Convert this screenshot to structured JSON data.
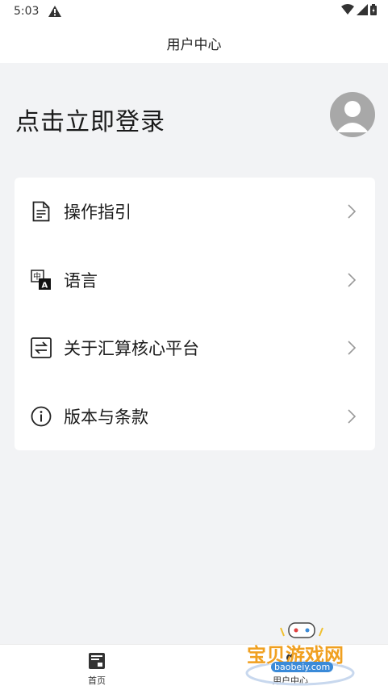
{
  "status_bar": {
    "time": "5:03"
  },
  "header": {
    "title": "用户中心"
  },
  "profile": {
    "login_text": "点击立即登录"
  },
  "menu": {
    "items": [
      {
        "label": "操作指引",
        "icon": "document-icon"
      },
      {
        "label": "语言",
        "icon": "translate-icon"
      },
      {
        "label": "关于汇算核心平台",
        "icon": "swap-icon"
      },
      {
        "label": "版本与条款",
        "icon": "info-icon"
      }
    ]
  },
  "bottom_nav": {
    "items": [
      {
        "label": "首页",
        "icon": "home-icon"
      },
      {
        "label": "用户中心",
        "icon": "user-icon"
      }
    ]
  },
  "watermark": {
    "text": "宝贝游戏网",
    "url": "baobeiy.com"
  },
  "colors": {
    "background": "#f2f3f5",
    "card": "#ffffff",
    "avatar": "#a8a8a8",
    "watermark": "#f0a020"
  }
}
